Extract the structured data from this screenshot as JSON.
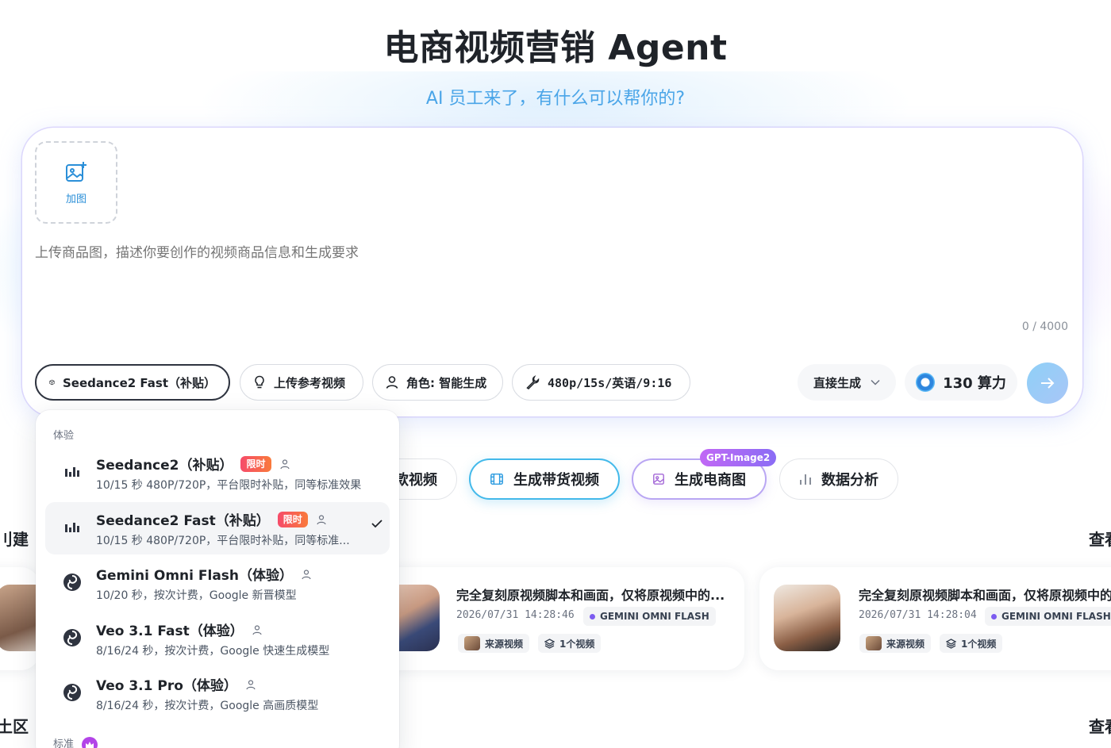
{
  "header": {
    "title": "电商视频营销 Agent",
    "subtitle": "AI 员工来了，有什么可以帮你的?"
  },
  "composer": {
    "add_image_label": "加图",
    "placeholder": "上传商品图，描述你要创作的视频商品信息和生成要求",
    "char_count": "0 / 4000",
    "model_chip": "Seedance2 Fast（补贴）",
    "ref_video_chip": "上传参考视频",
    "role_chip": "角色: 智能生成",
    "spec_chip": "480p/15s/英语/9:16",
    "mode_select": "直接生成",
    "credits": "130 算力"
  },
  "actions": {
    "tab1_partial": "款视频",
    "tab2": "生成带货视频",
    "tab3": "生成电商图",
    "tab3_badge": "GPT-Image2",
    "tab4": "数据分析"
  },
  "sections": {
    "left_create_partial": "刂建",
    "left_community_partial": "土区",
    "right_view_partial_1": "查看",
    "right_view_partial_2": "查看"
  },
  "cards": [
    {
      "title": "完全复刻原视频脚本和画面，仅将原视频中的...",
      "time": "2026/07/31 14:28:46",
      "model": "GEMINI OMNI FLASH",
      "source": "来源视频",
      "count": "1个视频"
    },
    {
      "title": "完全复刻原视频脚本和画面，仅将原视频中的...",
      "time": "2026/07/31 14:28:04",
      "model": "GEMINI OMNI FLASH",
      "source": "来源视频",
      "count": "1个视频"
    }
  ],
  "dropdown": {
    "group1": "体验",
    "group2": "标准",
    "limit_badge": "限时",
    "options": [
      {
        "name": "Seedance2（补贴）",
        "desc": "10/15 秒 480P/720P，平台限时补贴，同等标准效果",
        "icon": "bars-icon"
      },
      {
        "name": "Seedance2 Fast（补贴）",
        "desc": "10/15 秒 480P/720P，平台限时补贴，同等标准...",
        "icon": "bars-icon"
      },
      {
        "name": "Gemini Omni Flash（体验）",
        "desc": "10/20 秒，按次计费，Google 新晋模型",
        "icon": "swirl-icon"
      },
      {
        "name": "Veo 3.1 Fast（体验）",
        "desc": "8/16/24 秒，按次计费，Google 快速生成模型",
        "icon": "swirl-icon"
      },
      {
        "name": "Veo 3.1 Pro（体验）",
        "desc": "8/16/24 秒，按次计费，Google 高画质模型",
        "icon": "swirl-icon"
      }
    ]
  },
  "colors": {
    "accent_blue": "#43b9ea",
    "accent_purple": "#b9a6f3",
    "limit_red": "#f64b6a"
  }
}
